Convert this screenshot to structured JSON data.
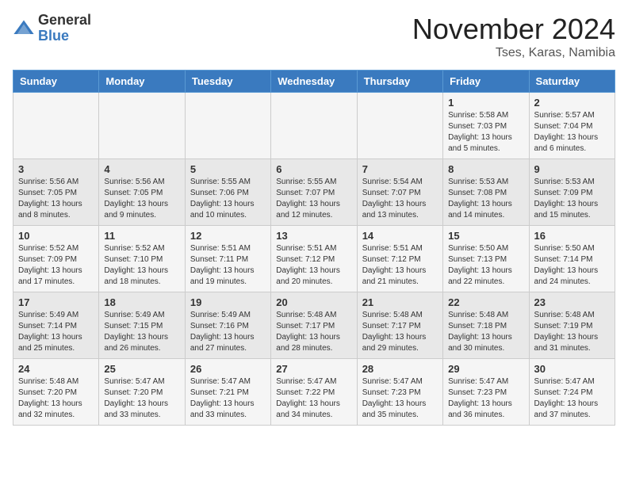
{
  "header": {
    "logo_general": "General",
    "logo_blue": "Blue",
    "month_title": "November 2024",
    "location": "Tses, Karas, Namibia"
  },
  "weekdays": [
    "Sunday",
    "Monday",
    "Tuesday",
    "Wednesday",
    "Thursday",
    "Friday",
    "Saturday"
  ],
  "weeks": [
    [
      {
        "day": "",
        "info": ""
      },
      {
        "day": "",
        "info": ""
      },
      {
        "day": "",
        "info": ""
      },
      {
        "day": "",
        "info": ""
      },
      {
        "day": "",
        "info": ""
      },
      {
        "day": "1",
        "info": "Sunrise: 5:58 AM\nSunset: 7:03 PM\nDaylight: 13 hours\nand 5 minutes."
      },
      {
        "day": "2",
        "info": "Sunrise: 5:57 AM\nSunset: 7:04 PM\nDaylight: 13 hours\nand 6 minutes."
      }
    ],
    [
      {
        "day": "3",
        "info": "Sunrise: 5:56 AM\nSunset: 7:05 PM\nDaylight: 13 hours\nand 8 minutes."
      },
      {
        "day": "4",
        "info": "Sunrise: 5:56 AM\nSunset: 7:05 PM\nDaylight: 13 hours\nand 9 minutes."
      },
      {
        "day": "5",
        "info": "Sunrise: 5:55 AM\nSunset: 7:06 PM\nDaylight: 13 hours\nand 10 minutes."
      },
      {
        "day": "6",
        "info": "Sunrise: 5:55 AM\nSunset: 7:07 PM\nDaylight: 13 hours\nand 12 minutes."
      },
      {
        "day": "7",
        "info": "Sunrise: 5:54 AM\nSunset: 7:07 PM\nDaylight: 13 hours\nand 13 minutes."
      },
      {
        "day": "8",
        "info": "Sunrise: 5:53 AM\nSunset: 7:08 PM\nDaylight: 13 hours\nand 14 minutes."
      },
      {
        "day": "9",
        "info": "Sunrise: 5:53 AM\nSunset: 7:09 PM\nDaylight: 13 hours\nand 15 minutes."
      }
    ],
    [
      {
        "day": "10",
        "info": "Sunrise: 5:52 AM\nSunset: 7:09 PM\nDaylight: 13 hours\nand 17 minutes."
      },
      {
        "day": "11",
        "info": "Sunrise: 5:52 AM\nSunset: 7:10 PM\nDaylight: 13 hours\nand 18 minutes."
      },
      {
        "day": "12",
        "info": "Sunrise: 5:51 AM\nSunset: 7:11 PM\nDaylight: 13 hours\nand 19 minutes."
      },
      {
        "day": "13",
        "info": "Sunrise: 5:51 AM\nSunset: 7:12 PM\nDaylight: 13 hours\nand 20 minutes."
      },
      {
        "day": "14",
        "info": "Sunrise: 5:51 AM\nSunset: 7:12 PM\nDaylight: 13 hours\nand 21 minutes."
      },
      {
        "day": "15",
        "info": "Sunrise: 5:50 AM\nSunset: 7:13 PM\nDaylight: 13 hours\nand 22 minutes."
      },
      {
        "day": "16",
        "info": "Sunrise: 5:50 AM\nSunset: 7:14 PM\nDaylight: 13 hours\nand 24 minutes."
      }
    ],
    [
      {
        "day": "17",
        "info": "Sunrise: 5:49 AM\nSunset: 7:14 PM\nDaylight: 13 hours\nand 25 minutes."
      },
      {
        "day": "18",
        "info": "Sunrise: 5:49 AM\nSunset: 7:15 PM\nDaylight: 13 hours\nand 26 minutes."
      },
      {
        "day": "19",
        "info": "Sunrise: 5:49 AM\nSunset: 7:16 PM\nDaylight: 13 hours\nand 27 minutes."
      },
      {
        "day": "20",
        "info": "Sunrise: 5:48 AM\nSunset: 7:17 PM\nDaylight: 13 hours\nand 28 minutes."
      },
      {
        "day": "21",
        "info": "Sunrise: 5:48 AM\nSunset: 7:17 PM\nDaylight: 13 hours\nand 29 minutes."
      },
      {
        "day": "22",
        "info": "Sunrise: 5:48 AM\nSunset: 7:18 PM\nDaylight: 13 hours\nand 30 minutes."
      },
      {
        "day": "23",
        "info": "Sunrise: 5:48 AM\nSunset: 7:19 PM\nDaylight: 13 hours\nand 31 minutes."
      }
    ],
    [
      {
        "day": "24",
        "info": "Sunrise: 5:48 AM\nSunset: 7:20 PM\nDaylight: 13 hours\nand 32 minutes."
      },
      {
        "day": "25",
        "info": "Sunrise: 5:47 AM\nSunset: 7:20 PM\nDaylight: 13 hours\nand 33 minutes."
      },
      {
        "day": "26",
        "info": "Sunrise: 5:47 AM\nSunset: 7:21 PM\nDaylight: 13 hours\nand 33 minutes."
      },
      {
        "day": "27",
        "info": "Sunrise: 5:47 AM\nSunset: 7:22 PM\nDaylight: 13 hours\nand 34 minutes."
      },
      {
        "day": "28",
        "info": "Sunrise: 5:47 AM\nSunset: 7:23 PM\nDaylight: 13 hours\nand 35 minutes."
      },
      {
        "day": "29",
        "info": "Sunrise: 5:47 AM\nSunset: 7:23 PM\nDaylight: 13 hours\nand 36 minutes."
      },
      {
        "day": "30",
        "info": "Sunrise: 5:47 AM\nSunset: 7:24 PM\nDaylight: 13 hours\nand 37 minutes."
      }
    ]
  ]
}
